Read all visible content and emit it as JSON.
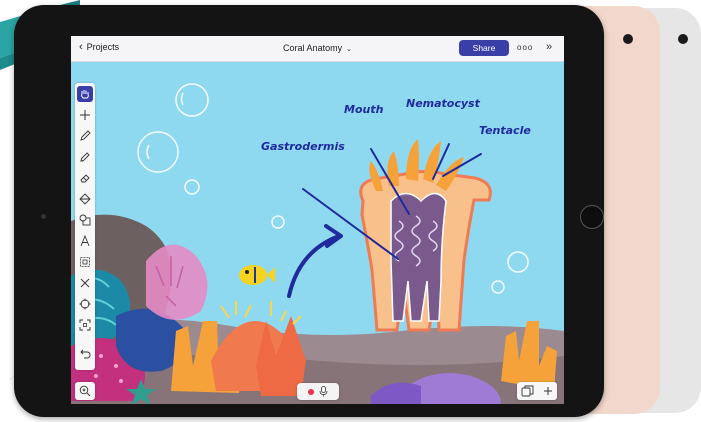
{
  "app": {
    "back_label": "Projects",
    "document_title": "Coral Anatomy",
    "share_label": "Share",
    "more_label": "ooo",
    "collapse_label": "»"
  },
  "toolbar": {
    "tools": [
      "hand-tool",
      "add-tool",
      "pencil-tool",
      "marker-tool",
      "eraser-tool",
      "fill-tool",
      "shapes-tool",
      "text-tool",
      "media-tool",
      "cross-tool",
      "target-tool",
      "crop-tool",
      "undo-tool"
    ],
    "active": "hand-tool"
  },
  "drawing_labels": {
    "mouth": "Mouth",
    "nematocyst": "Nematocyst",
    "tentacle": "Tentacle",
    "gastrodermis": "Gastrodermis"
  },
  "colors": {
    "canvas_bg": "#8fd9f0",
    "accent": "#3a3fa7",
    "label_ink": "#1f2a9c",
    "record": "#e8334a",
    "ipad_body": "#141414",
    "gold_body": "#f2d8cc",
    "silver_body": "#e6e6e6",
    "teal_corner": "#2aa5a3"
  }
}
